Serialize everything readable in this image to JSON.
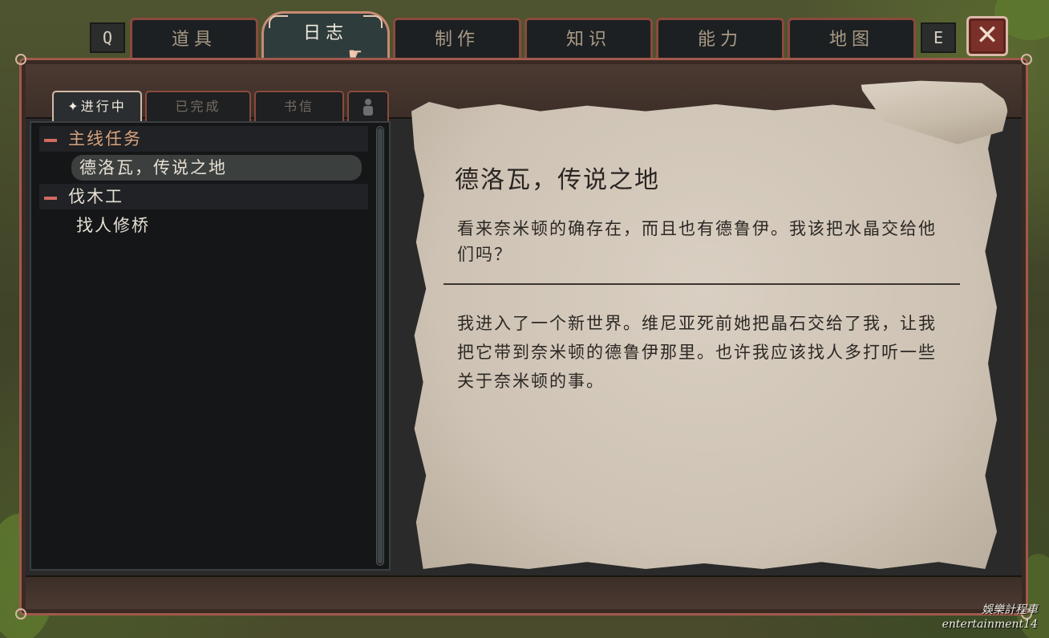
{
  "top_tabs": {
    "prev_key": "Q",
    "next_key": "E",
    "items": [
      {
        "label": "道具"
      },
      {
        "label": "日志"
      },
      {
        "label": "制作"
      },
      {
        "label": "知识"
      },
      {
        "label": "能力"
      },
      {
        "label": "地图"
      }
    ],
    "active_index": 1
  },
  "sub_tabs": {
    "items": [
      {
        "label": "✦进行中"
      },
      {
        "label": "已完成"
      },
      {
        "label": "书信"
      }
    ],
    "active_index": 0,
    "extra_icon": "person-icon"
  },
  "quest_list": {
    "categories": [
      {
        "label": "主线任务",
        "quests": [
          {
            "label": "德洛瓦，传说之地",
            "selected": true
          }
        ]
      },
      {
        "label": "伐木工",
        "quests": [
          {
            "label": "找人修桥",
            "selected": false
          }
        ]
      }
    ]
  },
  "quest_detail": {
    "title": "德洛瓦，传说之地",
    "summary": "看来奈米顿的确存在，而且也有德鲁伊。我该把水晶交给他们吗？",
    "log": "我进入了一个新世界。维尼亚死前她把晶石交给了我，让我把它带到奈米顿的德鲁伊那里。也许我应该找人多打听一些关于奈米顿的事。"
  },
  "close_button": {
    "icon": "close-icon"
  },
  "watermark": {
    "line1": "娛樂計程車",
    "line2": "entertainment14"
  },
  "colors": {
    "frame_border": "#a05a4c",
    "tab_active": "#2f3c3c",
    "category_dash": "#d26a60",
    "parchment": "#d3c9bb"
  }
}
